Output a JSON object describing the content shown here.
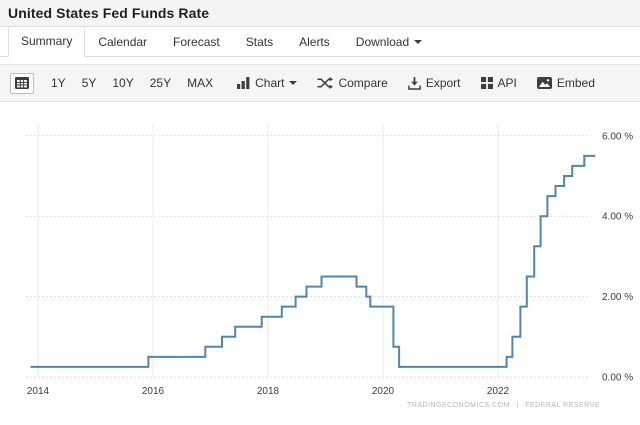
{
  "header": {
    "title": "United States Fed Funds Rate"
  },
  "tabs": {
    "items": [
      {
        "label": "Summary",
        "active": true,
        "caret": false
      },
      {
        "label": "Calendar",
        "active": false,
        "caret": false
      },
      {
        "label": "Forecast",
        "active": false,
        "caret": false
      },
      {
        "label": "Stats",
        "active": false,
        "caret": false
      },
      {
        "label": "Alerts",
        "active": false,
        "caret": false
      },
      {
        "label": "Download",
        "active": false,
        "caret": true
      }
    ]
  },
  "toolbar": {
    "calendar_icon": "calendar-grid-icon",
    "ranges": [
      "1Y",
      "5Y",
      "10Y",
      "25Y",
      "MAX"
    ],
    "buttons": [
      {
        "label": "Chart",
        "icon": "bar-chart-icon",
        "caret": true
      },
      {
        "label": "Compare",
        "icon": "compare-shuffle-icon",
        "caret": false
      },
      {
        "label": "Export",
        "icon": "download-export-icon",
        "caret": false
      },
      {
        "label": "API",
        "icon": "api-grid-icon",
        "caret": false
      },
      {
        "label": "Embed",
        "icon": "embed-image-icon",
        "caret": false
      }
    ]
  },
  "chart_data": {
    "type": "line",
    "step": true,
    "title": "United States Fed Funds Rate",
    "unit": "%",
    "line_color": "#4d85ba",
    "grid": {
      "horizontal": "dotted",
      "vertical": "solid",
      "on": true
    },
    "x_ticks": [
      2014,
      2016,
      2018,
      2020,
      2022
    ],
    "y_ticks": [
      0,
      2,
      4,
      6
    ],
    "y_tick_labels": [
      "0.00 %",
      "2.00 %",
      "4.00 %",
      "6.00 %"
    ],
    "xlim": [
      2013.87,
      2023.69
    ],
    "ylim": [
      0,
      6.6
    ],
    "legend": "none",
    "series": [
      {
        "name": "Fed Funds Rate",
        "points": [
          [
            2013.87,
            0.25
          ],
          [
            2015.92,
            0.5
          ],
          [
            2016.91,
            0.75
          ],
          [
            2017.2,
            1.0
          ],
          [
            2017.43,
            1.25
          ],
          [
            2017.89,
            1.5
          ],
          [
            2018.24,
            1.75
          ],
          [
            2018.48,
            2.0
          ],
          [
            2018.67,
            2.25
          ],
          [
            2018.93,
            2.5
          ],
          [
            2019.54,
            2.25
          ],
          [
            2019.71,
            2.0
          ],
          [
            2019.78,
            1.75
          ],
          [
            2020.18,
            0.75
          ],
          [
            2020.28,
            0.25
          ],
          [
            2022.15,
            0.5
          ],
          [
            2022.25,
            1.0
          ],
          [
            2022.39,
            1.75
          ],
          [
            2022.5,
            2.5
          ],
          [
            2022.63,
            3.25
          ],
          [
            2022.74,
            4.0
          ],
          [
            2022.86,
            4.5
          ],
          [
            2023.0,
            4.75
          ],
          [
            2023.15,
            5.0
          ],
          [
            2023.29,
            5.25
          ],
          [
            2023.5,
            5.5
          ],
          [
            2023.69,
            5.5
          ]
        ]
      }
    ]
  },
  "footer": {
    "source_left": "TRADINGECONOMICS.COM",
    "separator": "|",
    "source_right": "FEDERAL RESERVE"
  },
  "colors": {
    "line": "#4d85ba",
    "grid_dotted": "#d2d2d2",
    "grid_solid": "#ebebeb",
    "axis_text": "#3c3c3c",
    "toolbar_bg": "#f5f5f5",
    "header_bg": "#f4f4f4",
    "footer_text": "#b2b8be"
  }
}
